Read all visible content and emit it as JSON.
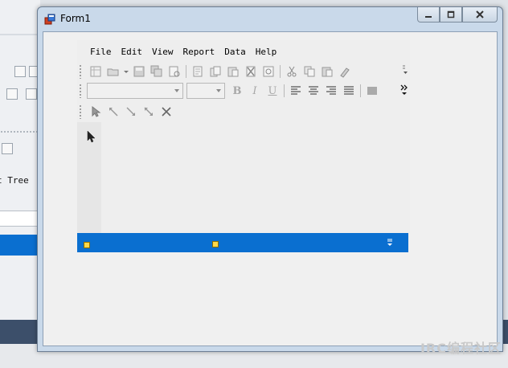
{
  "background": {
    "tree_label": "t Tree"
  },
  "window": {
    "title": "Form1",
    "caption_buttons": {
      "minimize": "minimize-icon",
      "maximize": "maximize-icon",
      "close": "close-icon"
    }
  },
  "menu": {
    "items": [
      "File",
      "Edit",
      "View",
      "Report",
      "Data",
      "Help"
    ]
  },
  "toolbar1": {
    "icons": [
      "new-report-icon",
      "open-icon",
      "save-icon",
      "save-all-icon",
      "print-preview-icon",
      "page-setup-icon",
      "copy-page-icon",
      "paste-page-icon",
      "delete-icon",
      "zoom-icon",
      "cut-icon",
      "copy-icon",
      "paste-icon",
      "format-painter-icon"
    ]
  },
  "toolbar2": {
    "font_name": "",
    "font_size": "",
    "format_buttons": [
      "B",
      "I",
      "U"
    ],
    "align_icons": [
      "align-left-icon",
      "align-center-icon",
      "align-right-icon",
      "justify-icon",
      "barcode-icon"
    ]
  },
  "toolbar3": {
    "icons": [
      "pointer-icon",
      "line-up-left-icon",
      "line-down-right-icon",
      "arrow-down-right-icon",
      "delete-x-icon"
    ]
  },
  "colors": {
    "accent_blue": "#0a6fd0",
    "client_bg": "#f0f0f0",
    "window_frame": "#c9d9ea"
  },
  "watermark": "IRC编程社区"
}
